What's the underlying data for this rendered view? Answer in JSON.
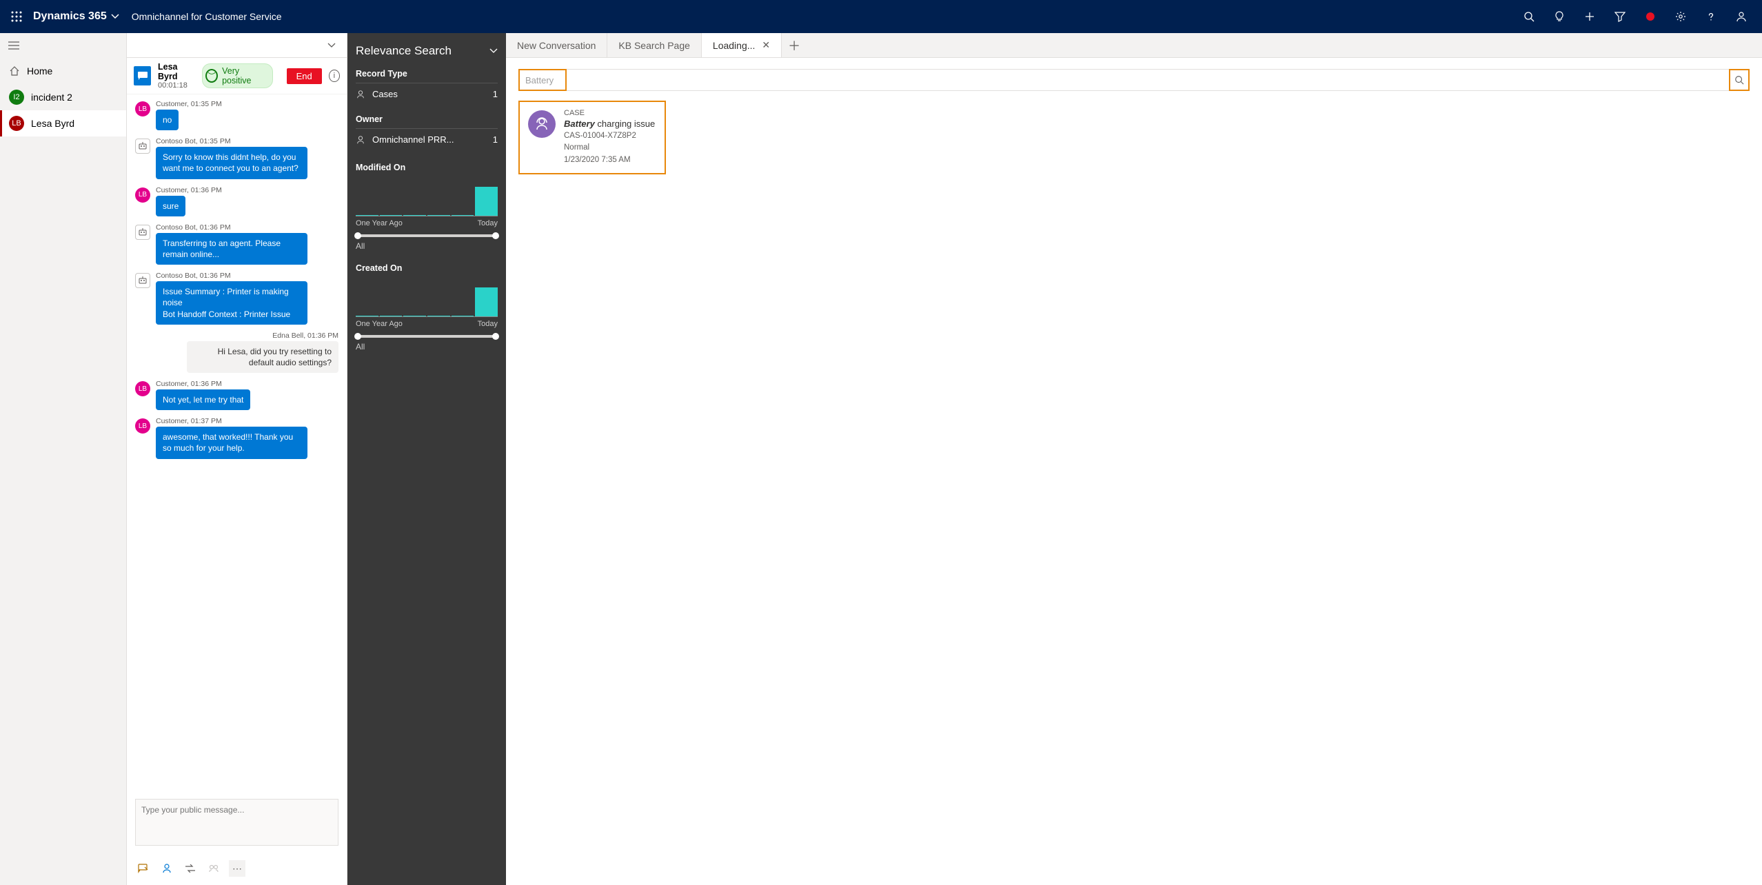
{
  "topnav": {
    "brand": "Dynamics 365",
    "subtitle": "Omnichannel for Customer Service"
  },
  "sidebar": {
    "home": "Home",
    "items": [
      {
        "badge": "I2",
        "label": "incident 2",
        "color": "green"
      },
      {
        "badge": "LB",
        "label": "Lesa Byrd",
        "color": "maroon",
        "selected": true
      }
    ]
  },
  "session": {
    "customer_name": "Lesa Byrd",
    "elapsed": "00:01:18",
    "sentiment": "Very positive",
    "end_label": "End"
  },
  "messages": [
    {
      "who": "cust",
      "meta": "Customer, 01:35 PM",
      "text": "no"
    },
    {
      "who": "bot",
      "meta": "Contoso Bot, 01:35 PM",
      "text": "Sorry to know this didnt help, do you want me to connect you to an agent?"
    },
    {
      "who": "cust",
      "meta": "Customer, 01:36 PM",
      "text": "sure"
    },
    {
      "who": "bot",
      "meta": "Contoso Bot, 01:36 PM",
      "text": "Transferring to an agent. Please remain online..."
    },
    {
      "who": "bot",
      "meta": "Contoso Bot, 01:36 PM",
      "text": "Issue Summary : Printer is making noise\nBot Handoff Context : Printer Issue"
    },
    {
      "who": "agent",
      "meta": "Edna Bell,  01:36 PM",
      "text": "Hi Lesa, did you try resetting to default audio settings?"
    },
    {
      "who": "cust",
      "meta": "Customer, 01:36 PM",
      "text": "Not yet, let me try that"
    },
    {
      "who": "cust",
      "meta": "Customer, 01:37 PM",
      "text": "awesome, that worked!!! Thank you so much for your help."
    }
  ],
  "compose": {
    "placeholder": "Type your public message..."
  },
  "relevance": {
    "title": "Relevance Search",
    "record_type_label": "Record Type",
    "cases": {
      "label": "Cases",
      "count": "1"
    },
    "owner_label": "Owner",
    "owner": {
      "label": "Omnichannel PRR...",
      "count": "1"
    },
    "modified_label": "Modified On",
    "created_label": "Created On",
    "axis_left": "One Year Ago",
    "axis_right": "Today",
    "slider_label": "All"
  },
  "chart_data": [
    {
      "type": "bar",
      "title": "Modified On",
      "categories": [
        "One Year Ago bin 1",
        "bin 2",
        "bin 3",
        "bin 4",
        "bin 5",
        "Today bin 6"
      ],
      "values": [
        0,
        0,
        0,
        0,
        0,
        1
      ],
      "xlabel": "",
      "ylabel": "",
      "ylim": [
        0,
        1
      ],
      "x_range_labels": [
        "One Year Ago",
        "Today"
      ],
      "slider_selection": "All"
    },
    {
      "type": "bar",
      "title": "Created On",
      "categories": [
        "One Year Ago bin 1",
        "bin 2",
        "bin 3",
        "bin 4",
        "bin 5",
        "Today bin 6"
      ],
      "values": [
        0,
        0,
        0,
        0,
        0,
        1
      ],
      "xlabel": "",
      "ylabel": "",
      "ylim": [
        0,
        1
      ],
      "x_range_labels": [
        "One Year Ago",
        "Today"
      ],
      "slider_selection": "All"
    }
  ],
  "tabs": {
    "items": [
      {
        "label": "New Conversation"
      },
      {
        "label": "KB Search Page"
      },
      {
        "label": "Loading...",
        "active": true,
        "closable": true
      }
    ]
  },
  "search": {
    "value": "Battery"
  },
  "result": {
    "type": "CASE",
    "title_bold": "Battery",
    "title_rest": " charging issue",
    "case_no": "CAS-01004-X7Z8P2",
    "priority": "Normal",
    "date": "1/23/2020 7:35 AM"
  }
}
